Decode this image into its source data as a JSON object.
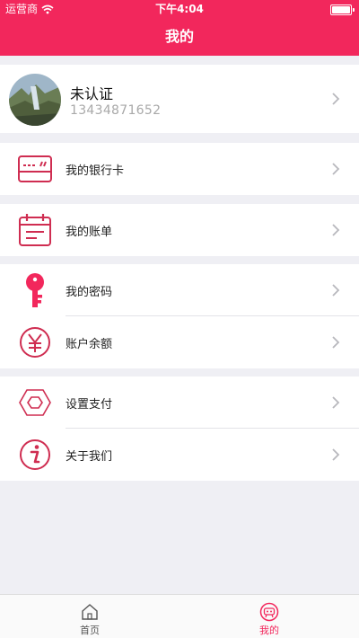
{
  "status_bar": {
    "carrier": "运营商",
    "time": "下午4:04"
  },
  "header": {
    "title": "我的"
  },
  "profile": {
    "name": "未认证",
    "phone": "13434871652"
  },
  "menu": {
    "bank_card": "我的银行卡",
    "bill": "我的账单",
    "password": "我的密码",
    "balance": "账户余额",
    "payment_settings": "设置支付",
    "about": "关于我们"
  },
  "tabbar": {
    "home": "首页",
    "mine": "我的",
    "active_color": "#f2275c",
    "inactive_color": "#555555"
  },
  "colors": {
    "brand": "#f2275c",
    "icon": "#cf2d51"
  }
}
